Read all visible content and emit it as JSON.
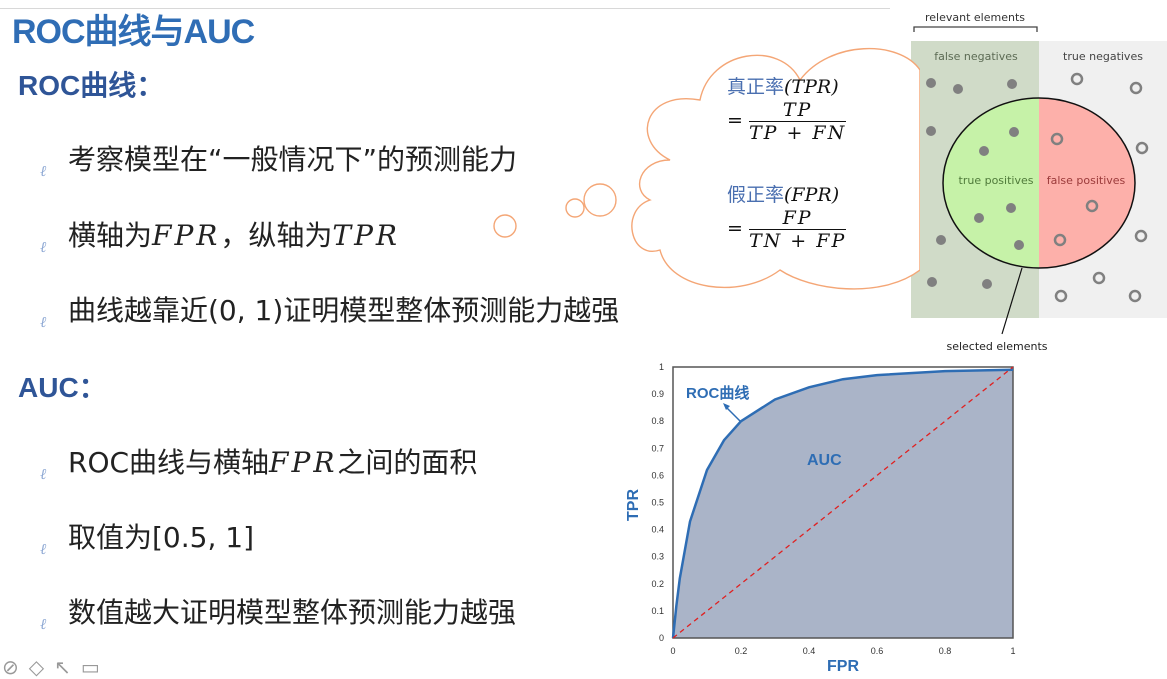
{
  "slide": {
    "title": "ROC曲线与AUC",
    "roc_section": {
      "heading": "ROC曲线：",
      "bullets": [
        {
          "text": "考察模型在“一般情况下”的预测能力"
        },
        {
          "pre": "横轴为",
          "m1": "FPR",
          "mid": "，纵轴为",
          "m2": "TPR"
        },
        {
          "text": "曲线越靠近(0, 1)证明模型整体预测能力越强"
        }
      ]
    },
    "auc_section": {
      "heading": "AUC：",
      "bullets": [
        {
          "pre": "ROC曲线与横轴",
          "m1": "FPR",
          "post": "之间的面积"
        },
        {
          "text": "取值为[0.5, 1]"
        },
        {
          "text": "数值越大证明模型整体预测能力越强"
        }
      ]
    },
    "bullet_glyph": "ℓ"
  },
  "cloud": {
    "tpr_label": "真正率",
    "tpr_abbr": "(TPR)",
    "tpr_num": "TP",
    "tpr_den": "TP + FN",
    "fpr_label": "假正率",
    "fpr_abbr": "(FPR)",
    "fpr_num": "FP",
    "fpr_den": "TN + FP",
    "eq": "="
  },
  "diagram": {
    "relevant": "relevant elements",
    "fn": "false negatives",
    "tn": "true negatives",
    "tp": "true positives",
    "fp": "false positives",
    "selected": "selected elements"
  },
  "chart_data": {
    "type": "area",
    "xlabel": "FPR",
    "ylabel": "TPR",
    "xlim": [
      0,
      1
    ],
    "ylim": [
      0,
      1
    ],
    "xticks": [
      "0",
      "0.2",
      "0.4",
      "0.6",
      "0.8",
      "1"
    ],
    "yticks": [
      "0",
      "0.1",
      "0.2",
      "0.3",
      "0.4",
      "0.5",
      "0.6",
      "0.7",
      "0.8",
      "0.9",
      "1"
    ],
    "series": [
      {
        "name": "ROC曲线",
        "x": [
          0,
          0.01,
          0.02,
          0.05,
          0.1,
          0.15,
          0.2,
          0.3,
          0.4,
          0.5,
          0.6,
          0.8,
          1
        ],
        "y": [
          0,
          0.12,
          0.22,
          0.43,
          0.62,
          0.73,
          0.8,
          0.88,
          0.925,
          0.955,
          0.97,
          0.985,
          0.99
        ],
        "color": "#2e6db4",
        "fill": "#aab4c8"
      },
      {
        "x": [
          0,
          1
        ],
        "y": [
          0,
          1
        ],
        "color": "#e02020",
        "style": "dashed"
      }
    ],
    "annotations": [
      "ROC曲线",
      "AUC"
    ]
  },
  "toolbar": {
    "icons": [
      "pen-icon",
      "eraser-icon",
      "pointer-icon",
      "camera-icon"
    ]
  }
}
